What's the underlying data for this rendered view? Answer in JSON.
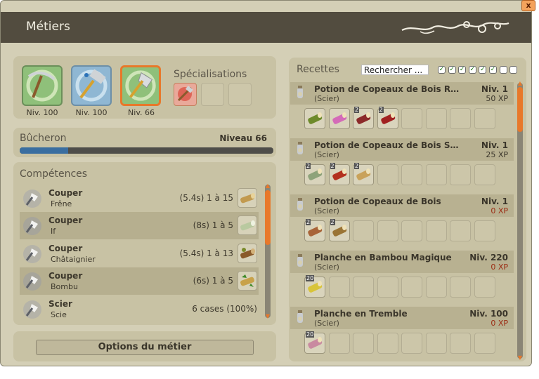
{
  "window": {
    "title": "Métiers",
    "close_label": "x"
  },
  "jobs": [
    {
      "level_label": "Niv. 100",
      "icon": "pickaxe-icon"
    },
    {
      "level_label": "Niv. 100",
      "icon": "hammer-icon"
    },
    {
      "level_label": "Niv. 66",
      "icon": "axe-icon"
    }
  ],
  "specializations": {
    "title": "Spécialisations",
    "slots": [
      "specialization-icon",
      "",
      ""
    ]
  },
  "progress": {
    "job_name": "Bûcheron",
    "level_label": "Niveau 66",
    "xp_fraction": 0.19
  },
  "skills": {
    "title": "Compétences",
    "rows": [
      {
        "action": "Couper",
        "target": "Frêne",
        "value": "(5.4s) 1 à 15",
        "resource_icon": "ash-log-icon"
      },
      {
        "action": "Couper",
        "target": "If",
        "value": "(8s) 1 à 5",
        "resource_icon": "yew-log-icon"
      },
      {
        "action": "Couper",
        "target": "Châtaignier",
        "value": "(5.4s) 1 à 13",
        "resource_icon": "chestnut-log-icon"
      },
      {
        "action": "Couper",
        "target": "Bombu",
        "value": "(6s) 1 à 5",
        "resource_icon": "bombu-log-icon"
      },
      {
        "action": "Scier",
        "target": "Scie",
        "value": "6 cases (100%)",
        "resource_icon": ""
      }
    ]
  },
  "options_button": "Options du métier",
  "recipes": {
    "title": "Recettes",
    "search_value": "Rechercher ...",
    "filters": [
      true,
      true,
      true,
      true,
      true,
      true,
      false,
      false
    ],
    "items": [
      {
        "name": "Potion de Copeaux de Bois Rares",
        "type": "(Scier)",
        "level": "Niv. 1",
        "xp": "50 XP",
        "xp_zero": false,
        "ingredients": [
          {
            "qty": "",
            "color": "#6d8a2a"
          },
          {
            "qty": "",
            "color": "#d46bb8"
          },
          {
            "qty": "2",
            "color": "#8c2a2a"
          },
          {
            "qty": "2",
            "color": "#a12121"
          }
        ]
      },
      {
        "name": "Potion de Copeaux de Bois Soli...",
        "type": "(Scier)",
        "level": "Niv. 1",
        "xp": "25 XP",
        "xp_zero": false,
        "ingredients": [
          {
            "qty": "2",
            "color": "#8ea37a"
          },
          {
            "qty": "2",
            "color": "#b3301e"
          },
          {
            "qty": "2",
            "color": "#c9a25a"
          }
        ]
      },
      {
        "name": "Potion de Copeaux de Bois",
        "type": "(Scier)",
        "level": "Niv. 1",
        "xp": "0 XP",
        "xp_zero": true,
        "ingredients": [
          {
            "qty": "2",
            "color": "#a86438"
          },
          {
            "qty": "2",
            "color": "#9a7434"
          }
        ]
      },
      {
        "name": "Planche en Bambou Magique",
        "type": "(Scier)",
        "level": "Niv. 220",
        "xp": "0 XP",
        "xp_zero": true,
        "ingredients": [
          {
            "qty": "20",
            "color": "#d8c43a"
          }
        ]
      },
      {
        "name": "Planche en Tremble",
        "type": "(Scier)",
        "level": "Niv. 100",
        "xp": "0 XP",
        "xp_zero": true,
        "ingredients": [
          {
            "qty": "20",
            "color": "#c98aa0"
          }
        ]
      }
    ]
  },
  "colors": {
    "title_bar": "#524c3f",
    "accent_orange": "#e8782a",
    "xp_fill": "#3a6ea0",
    "zero_xp": "#9b2a12"
  }
}
